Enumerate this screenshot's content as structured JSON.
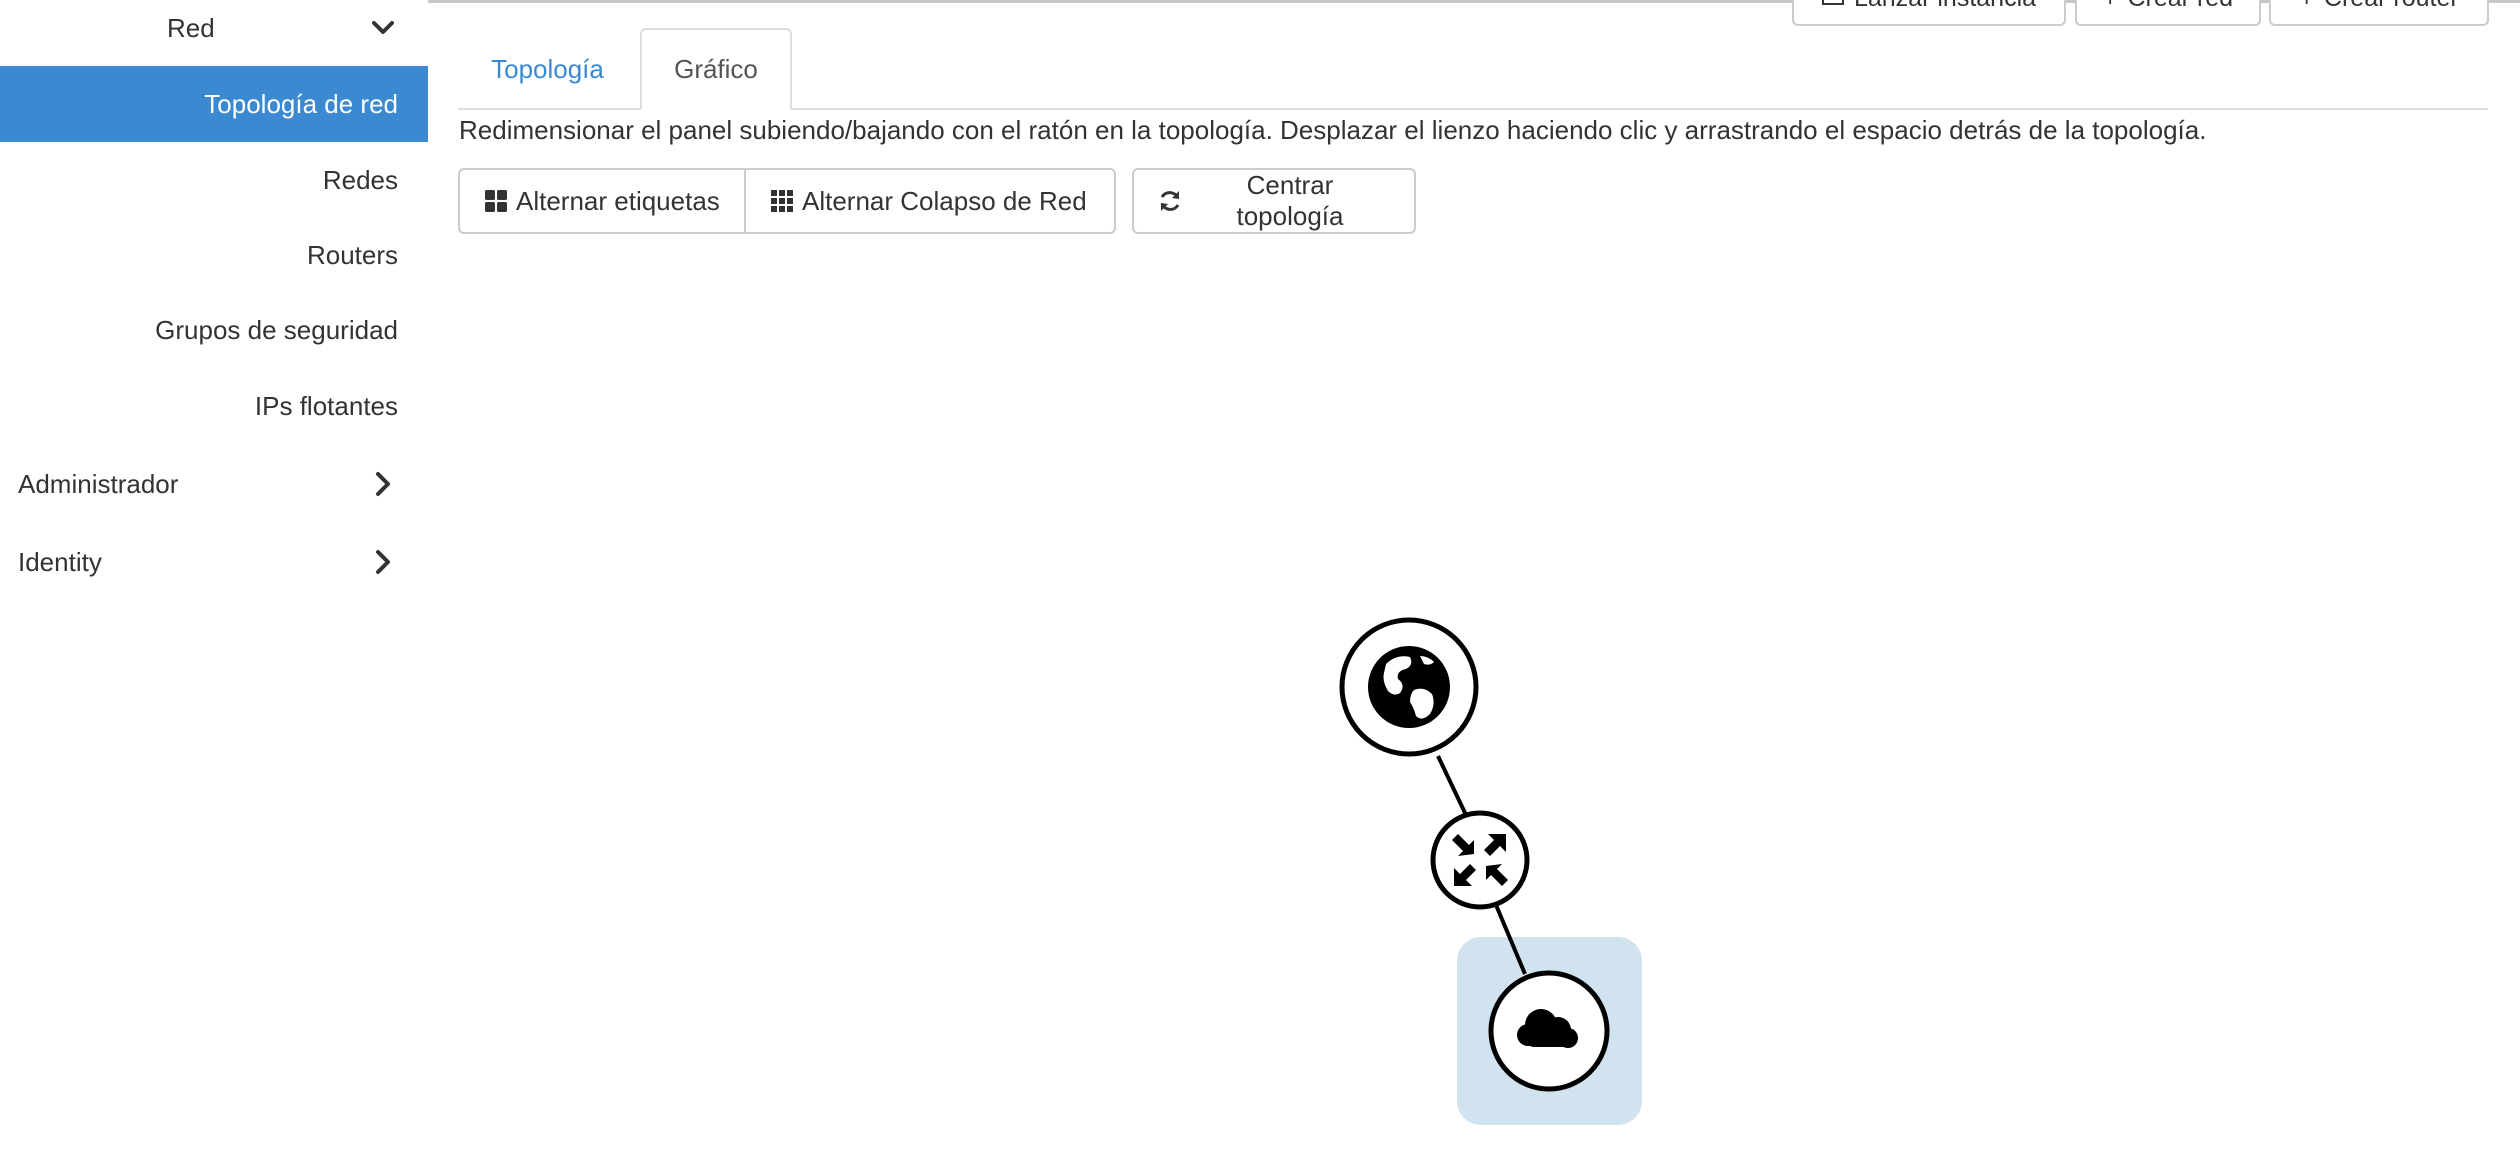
{
  "sidebar": {
    "red_section": "Red",
    "items": [
      {
        "label": "Topología de red",
        "active": true
      },
      {
        "label": "Redes",
        "active": false
      },
      {
        "label": "Routers",
        "active": false
      },
      {
        "label": "Grupos de seguridad",
        "active": false
      },
      {
        "label": "IPs flotantes",
        "active": false
      }
    ],
    "admin_section": "Administrador",
    "identity_section": "Identity"
  },
  "header_buttons": {
    "launch_instance": "Lanzar instancia",
    "create_network": "Crear red",
    "create_router": "Crear router"
  },
  "tabs": {
    "topology": "Topología",
    "graph": "Gráfico",
    "active": "graph"
  },
  "help_text": "Redimensionar el panel subiendo/bajando con el ratón en la topología. Desplazar el lienzo haciendo clic y arrastrando el espacio detrás de la topología.",
  "toolbar": {
    "toggle_labels": "Alternar etiquetas",
    "toggle_network_collapse": "Alternar Colapso de Red",
    "center_topology": "Centrar topología"
  },
  "topology": {
    "nodes": [
      {
        "type": "external-network",
        "icon": "globe-icon"
      },
      {
        "type": "router",
        "icon": "arrows-icon"
      },
      {
        "type": "network",
        "icon": "cloud-icon",
        "highlighted": true
      }
    ]
  },
  "colors": {
    "accent": "#3b89d1",
    "network_highlight": "#d2e3f0",
    "border": "#cccccc"
  }
}
